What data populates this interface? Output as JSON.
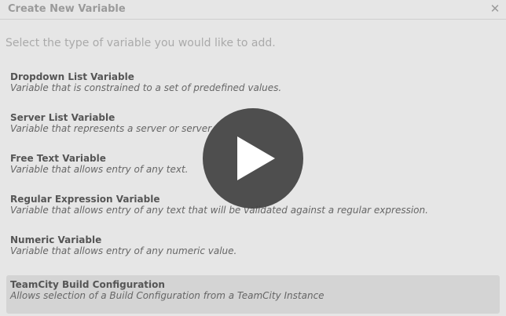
{
  "dialog": {
    "title": "Create New Variable",
    "close_glyph": "✕",
    "instructions": "Select the type of variable you would like to add."
  },
  "variable_types": [
    {
      "title": "Dropdown List Variable",
      "description": "Variable that is constrained to a set of predefined values."
    },
    {
      "title": "Server List Variable",
      "description": "Variable that represents a server or server"
    },
    {
      "title": "Free Text Variable",
      "description": "Variable that allows entry of any text."
    },
    {
      "title": "Regular Expression Variable",
      "description": "Variable that allows entry of any text that will be validated against a regular expression."
    },
    {
      "title": "Numeric Variable",
      "description": "Variable that allows entry of any numeric value."
    },
    {
      "title": "TeamCity Build Configuration",
      "description": "Allows selection of a Build Configuration from a TeamCity Instance"
    }
  ],
  "overlay": {
    "icon": "play-icon"
  }
}
